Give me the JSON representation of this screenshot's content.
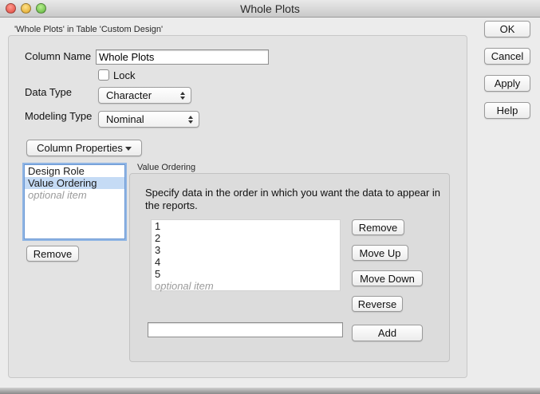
{
  "window": {
    "title": "Whole Plots",
    "header_label": "'Whole Plots' in Table 'Custom Design'"
  },
  "form": {
    "column_name_label": "Column Name",
    "column_name_value": "Whole Plots",
    "lock_label": "Lock",
    "lock_checked": false,
    "data_type_label": "Data Type",
    "data_type_value": "Character",
    "modeling_type_label": "Modeling Type",
    "modeling_type_value": "Nominal",
    "column_properties_label": "Column Properties"
  },
  "properties_list": {
    "items": [
      {
        "label": "Design Role",
        "selected": false
      },
      {
        "label": "Value Ordering",
        "selected": true
      }
    ],
    "placeholder": "optional item",
    "remove_label": "Remove"
  },
  "value_ordering": {
    "group_label": "Value Ordering",
    "instructions": "Specify data in the order in which you want the data to appear in the reports.",
    "values": [
      "1",
      "2",
      "3",
      "4",
      "5"
    ],
    "placeholder": "optional item",
    "new_value": "",
    "buttons": {
      "remove": "Remove",
      "move_up": "Move Up",
      "move_down": "Move Down",
      "reverse": "Reverse",
      "add": "Add"
    }
  },
  "side_buttons": {
    "ok": "OK",
    "cancel": "Cancel",
    "apply": "Apply",
    "help": "Help"
  }
}
